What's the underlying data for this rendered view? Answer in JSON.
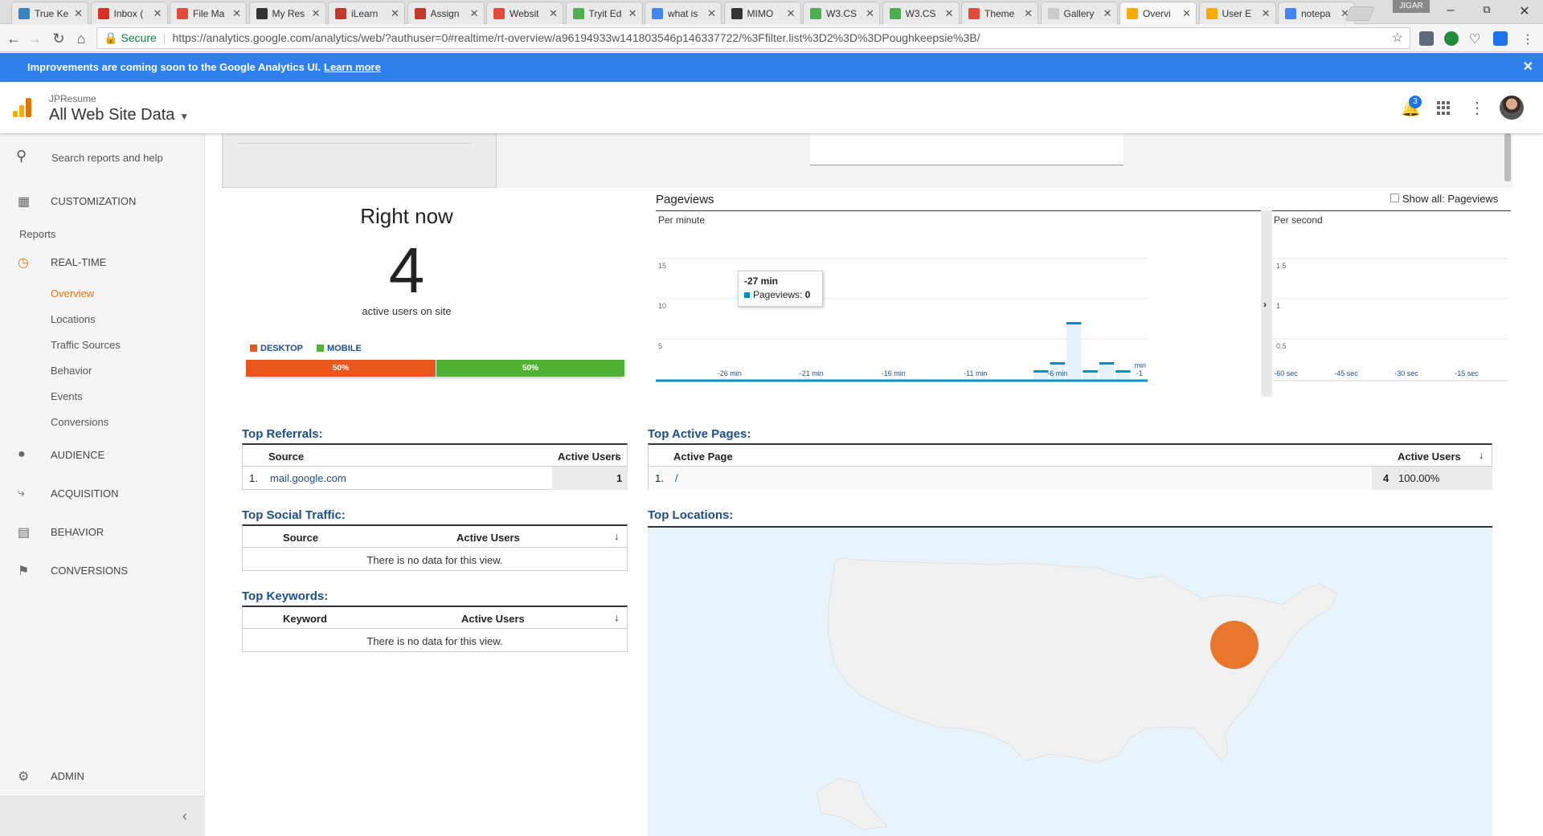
{
  "browser": {
    "tabs": [
      {
        "label": "True Ke",
        "color": "#3b82c4"
      },
      {
        "label": "Inbox (",
        "color": "#d93025"
      },
      {
        "label": "File Ma",
        "color": "#e24b3b"
      },
      {
        "label": "My Res",
        "color": "#333333"
      },
      {
        "label": "iLearn",
        "color": "#c0392b"
      },
      {
        "label": "Assign",
        "color": "#c0392b"
      },
      {
        "label": "Websit",
        "color": "#e24b3b"
      },
      {
        "label": "Tryit Ed",
        "color": "#4caf50"
      },
      {
        "label": "what is",
        "color": "#4285f4"
      },
      {
        "label": "MIMO",
        "color": "#333333"
      },
      {
        "label": "W3.CS",
        "color": "#4caf50"
      },
      {
        "label": "W3.CS",
        "color": "#4caf50"
      },
      {
        "label": "Theme",
        "color": "#e24b3b"
      },
      {
        "label": "Gallery",
        "color": "#cccccc"
      },
      {
        "label": "Overvi",
        "color": "#f9ab00"
      },
      {
        "label": "User E",
        "color": "#f9ab00"
      },
      {
        "label": "notepa",
        "color": "#4285f4"
      }
    ],
    "profile": "JIGAR",
    "secure_label": "Secure",
    "url": "https://analytics.google.com/analytics/web/?authuser=0#realtime/rt-overview/a96194933w141803546p146337722/%3Ffilter.list%3D2%3D%3DPoughkeepsie%3B/"
  },
  "banner": {
    "text": "Improvements are coming soon to the Google Analytics UI.",
    "link": "Learn more"
  },
  "header": {
    "account": "JPResume",
    "property": "All Web Site Data",
    "notification_count": "3"
  },
  "sidebar": {
    "search_placeholder": "Search reports and help",
    "customization": "CUSTOMIZATION",
    "reports": "Reports",
    "realtime": "REAL-TIME",
    "realtime_items": [
      "Overview",
      "Locations",
      "Traffic Sources",
      "Behavior",
      "Events",
      "Conversions"
    ],
    "audience": "AUDIENCE",
    "acquisition": "ACQUISITION",
    "behavior": "BEHAVIOR",
    "conversions": "CONVERSIONS",
    "admin": "ADMIN"
  },
  "rightnow": {
    "title": "Right now",
    "count": "4",
    "subtitle": "active users on site",
    "desktop_label": "DESKTOP",
    "mobile_label": "MOBILE",
    "desktop_pct": "50%",
    "mobile_pct": "50%",
    "desktop_share": 0.5,
    "colors": {
      "desktop": "#e8581c",
      "mobile": "#50b432"
    }
  },
  "pageviews": {
    "title": "Pageviews",
    "show_all": "Show all: Pageviews",
    "tooltip_time": "-27 min",
    "tooltip_label": "Pageviews:",
    "tooltip_value": "0"
  },
  "chart_data": [
    {
      "type": "bar",
      "title": "Per minute",
      "ylim": [
        0,
        15
      ],
      "yticks": [
        "15",
        "10",
        "5"
      ],
      "xticks": [
        "-26 min",
        "-21 min",
        "-16 min",
        "-11 min",
        "-6 min",
        "-1"
      ],
      "x_extra_label": "min",
      "minutes": [
        -30,
        -29,
        -28,
        -27,
        -26,
        -25,
        -24,
        -23,
        -22,
        -21,
        -20,
        -19,
        -18,
        -17,
        -16,
        -15,
        -14,
        -13,
        -12,
        -11,
        -10,
        -9,
        -8,
        -7,
        -6,
        -5,
        -4,
        -3,
        -2,
        -1
      ],
      "values": [
        0,
        0,
        0,
        0,
        0,
        0,
        0,
        0,
        0,
        0,
        0,
        0,
        0,
        0,
        0,
        0,
        0,
        0,
        0,
        0,
        0,
        0,
        0,
        1,
        2,
        7,
        1,
        2,
        1,
        0
      ],
      "color": "#058dc7"
    },
    {
      "type": "bar",
      "title": "Per second",
      "ylim": [
        0,
        1.5
      ],
      "yticks": [
        "1.5",
        "1",
        "0.5"
      ],
      "xticks": [
        "-60 sec",
        "-45 sec",
        "-30 sec",
        "-15 sec"
      ],
      "values": []
    }
  ],
  "referrals": {
    "title": "Top Referrals:",
    "col_source": "Source",
    "col_users": "Active Users",
    "rows": [
      {
        "rank": "1.",
        "source": "mail.google.com",
        "users": "1"
      }
    ]
  },
  "social": {
    "title": "Top Social Traffic:",
    "col_source": "Source",
    "col_users": "Active Users",
    "empty": "There is no data for this view."
  },
  "keywords": {
    "title": "Top Keywords:",
    "col_keyword": "Keyword",
    "col_users": "Active Users",
    "empty": "There is no data for this view."
  },
  "active_pages": {
    "title": "Top Active Pages:",
    "col_page": "Active Page",
    "col_users": "Active Users",
    "rows": [
      {
        "rank": "1.",
        "page": "/",
        "users": "4",
        "pct": "100.00%"
      }
    ]
  },
  "locations": {
    "title": "Top Locations:",
    "marker_color": "#e8762d"
  }
}
